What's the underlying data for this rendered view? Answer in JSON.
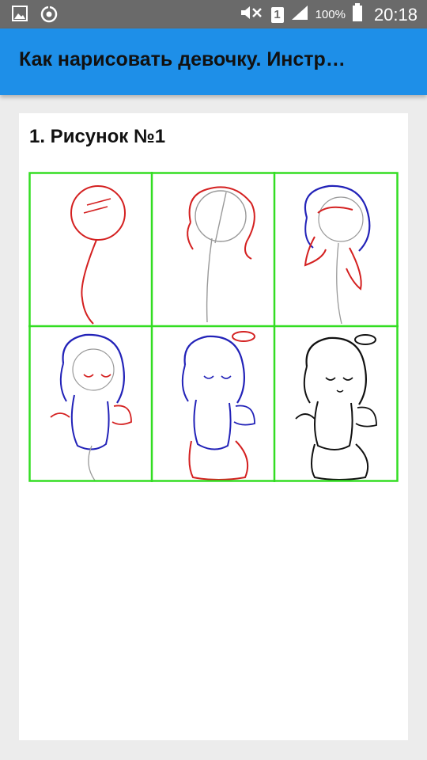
{
  "status_bar": {
    "battery_percent": "100%",
    "time": "20:18",
    "sim_slot": "1",
    "icons": [
      "gallery-icon",
      "sync-icon",
      "mute-icon",
      "sim-icon",
      "signal-icon",
      "battery-icon"
    ]
  },
  "app_bar": {
    "title": "Как нарисовать девочку. Инстр…",
    "background_color": "#1e8fe8"
  },
  "content": {
    "heading": "1. Рисунок №1",
    "image": {
      "description_name": "angel-girl-step-by-step-drawing",
      "grid_rows": 2,
      "grid_cols": 3,
      "grid_color": "#33dd22",
      "stroke_colors": [
        "#d42020",
        "#2222b8",
        "#111111",
        "#999999"
      ]
    }
  }
}
